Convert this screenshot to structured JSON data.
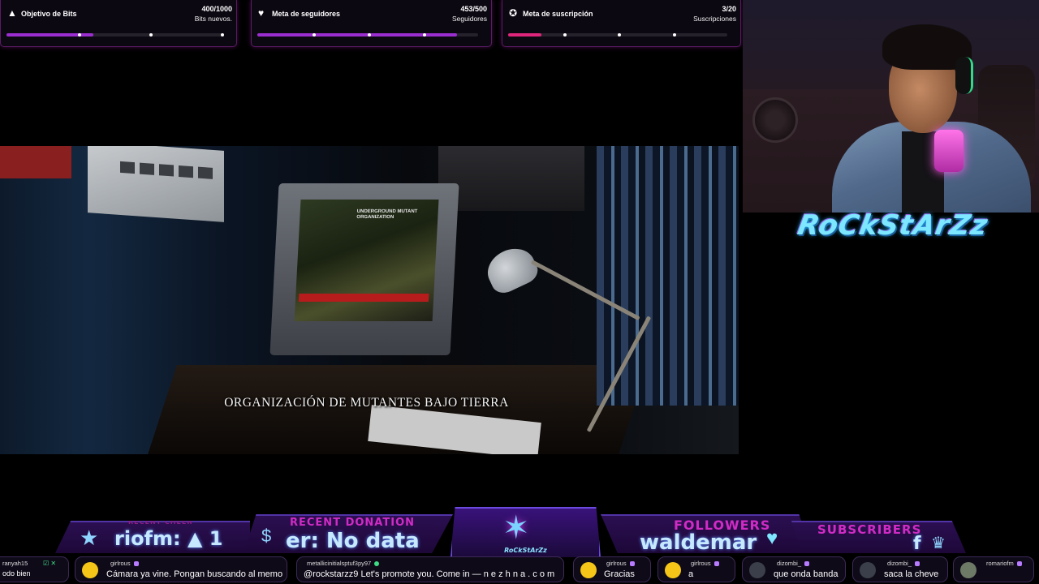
{
  "goals": [
    {
      "icon": "bits-icon",
      "glyph": "▲",
      "title": "Objetivo de Bits",
      "value": "400/1000",
      "sub": "Bits nuevos.",
      "progress": 0.4,
      "color": "#9b2ed0"
    },
    {
      "icon": "follower-icon",
      "glyph": "♥",
      "title": "Meta de seguidores",
      "value": "453/500",
      "sub": "Seguidores",
      "progress": 0.906,
      "color": "#9b2ed0"
    },
    {
      "icon": "subscription-icon",
      "glyph": "✪",
      "title": "Meta de suscripción",
      "value": "3/20",
      "sub": "Suscripciones",
      "progress": 0.15,
      "color": "#e0267c"
    }
  ],
  "video": {
    "subtitle": "ORGANIZACIÓN DE MUTANTES BAJO TIERRA",
    "screen_text": "UNDERGROUND MUTANT ORGANIZATION"
  },
  "branding": {
    "logo_text": "RoCkStArZz"
  },
  "overlay": {
    "recent_cheer": {
      "title": "RECENT CHEER",
      "value": "riofm: ▲ 1"
    },
    "recent_donation": {
      "title": "RECENT DONATION",
      "value": "er: No data"
    },
    "center_badge_text": "RoCkStArZz",
    "followers": {
      "title": "FOLLOWERS",
      "value": "waldemar"
    },
    "subscribers": {
      "title": "SUBSCRIBERS",
      "value": "f"
    }
  },
  "chat": [
    {
      "user": "ranyah15",
      "message": "odo bien",
      "avatar_color": "#333"
    },
    {
      "user": "girlrous",
      "message": "Cámara ya vine. Pongan buscando al memo",
      "avatar_color": "#f5c518"
    },
    {
      "user": "metallicinitialsptuf3py97",
      "message": "@rockstarzz9 Let's promote you. Come in — n e z h n a . c o m",
      "avatar_color": "#2a2a2a"
    },
    {
      "user": "girlrous",
      "message": "Gracias",
      "avatar_color": "#f5c518"
    },
    {
      "user": "girlrous",
      "message": "a",
      "avatar_color": "#f5c518"
    },
    {
      "user": "dizombi_",
      "message": "que onda banda",
      "avatar_color": "#3a3f4a"
    },
    {
      "user": "dizombi_",
      "message": "saca la cheve",
      "avatar_color": "#3a3f4a"
    },
    {
      "user": "romariofm",
      "message": "",
      "avatar_color": "#6c7a66"
    }
  ]
}
